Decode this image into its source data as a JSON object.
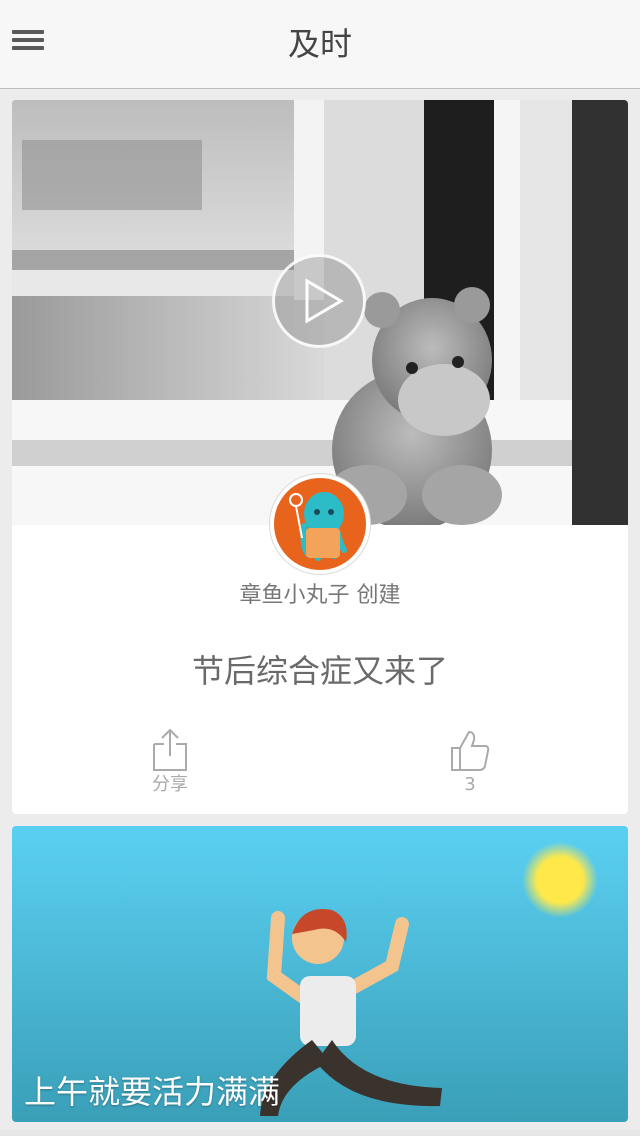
{
  "header": {
    "title": "及时",
    "menu_icon": "hamburger-menu-icon"
  },
  "feed": {
    "cards": [
      {
        "creator": "章鱼小丸子 创建",
        "title": "节后综合症又来了",
        "share_label": "分享",
        "like_count": "3",
        "media": "video",
        "play_icon": "play-icon"
      },
      {
        "title": "上午就要活力满满"
      }
    ]
  },
  "colors": {
    "accent_orange": "#e8641c",
    "sky_blue": "#5bc8ea"
  }
}
